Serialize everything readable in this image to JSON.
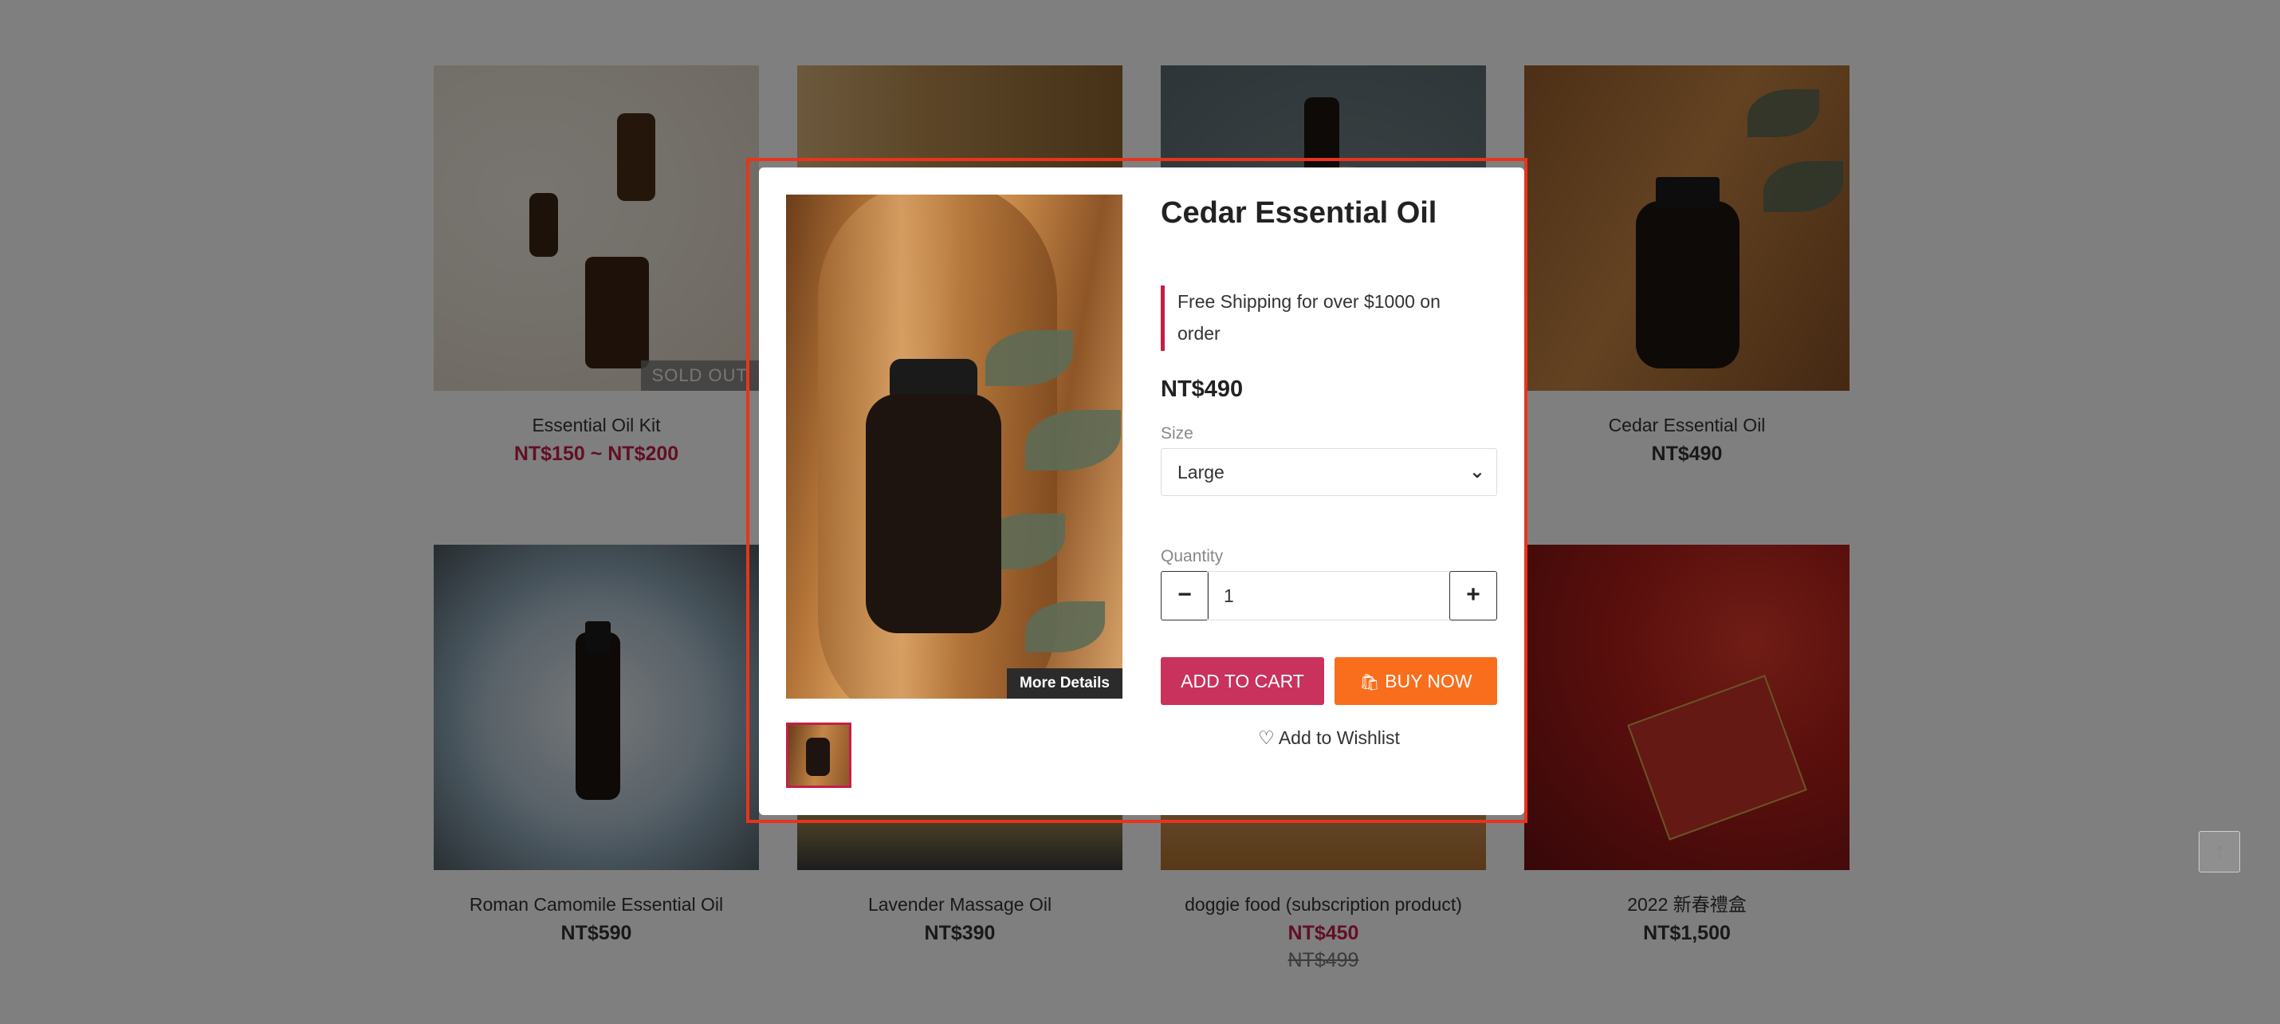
{
  "products": [
    {
      "name": "Essential Oil Kit",
      "price": "NT$150 ~ NT$200",
      "badge": "SOLD OUT"
    },
    {
      "name": "Roman Camomile Essential Oil",
      "price": "NT$590"
    },
    {
      "name": "Lavender Massage Oil",
      "price": "NT$390"
    },
    {
      "name": "doggie food (subscription product)",
      "price": "NT$450",
      "original_price": "NT$499"
    },
    {
      "name": "Cedar Essential Oil",
      "price": "NT$490"
    },
    {
      "name": "2022 新春禮盒",
      "price": "NT$1,500"
    }
  ],
  "modal": {
    "title": "Cedar Essential Oil",
    "promo": "Free Shipping for over $1000 on order",
    "price": "NT$490",
    "size_label": "Size",
    "size_value": "Large",
    "quantity_label": "Quantity",
    "quantity_value": "1",
    "minus": "−",
    "plus": "+",
    "add_to_cart": "ADD TO CART",
    "buy_now": "BUY NOW",
    "wishlist": "Add to Wishlist",
    "more_details": "More Details"
  },
  "icons": {
    "chevron": "⌄",
    "bag": "🛍",
    "heart": "♡",
    "arrow_up": "↑"
  },
  "colors": {
    "accent": "#c8325c",
    "sale_price": "#c41e49",
    "buy_now": "#f86e1d",
    "highlight_border": "#e8341c"
  }
}
